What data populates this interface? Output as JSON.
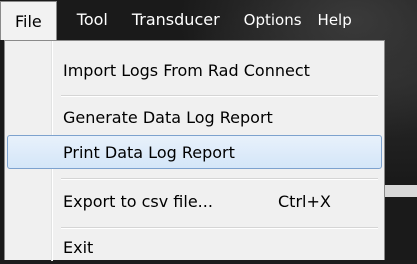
{
  "menubar": {
    "items": [
      {
        "label": "File"
      },
      {
        "label": "Tool"
      },
      {
        "label": "Transducer"
      },
      {
        "label": "Options"
      },
      {
        "label": "Help"
      }
    ]
  },
  "file_menu": {
    "items": [
      {
        "label": "Import Logs From Rad Connect"
      },
      {
        "label": "Generate Data Log Report"
      },
      {
        "label": "Print Data Log Report"
      },
      {
        "label": "Export to csv file...",
        "shortcut": "Ctrl+X"
      },
      {
        "label": "Exit"
      }
    ]
  },
  "colors": {
    "highlight_border": "#7da2ce",
    "menu_background": "#f0f0f0",
    "menubar_background": "#1a1a1a"
  }
}
